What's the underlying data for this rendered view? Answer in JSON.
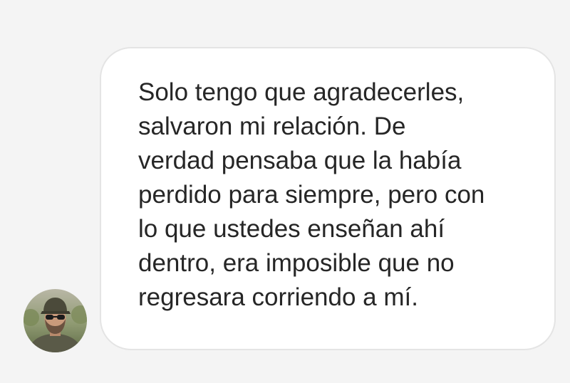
{
  "message": {
    "lines": [
      "Solo tengo que agradecerles,",
      "salvaron mi relación. De",
      "verdad pensaba que la había",
      "perdido para siempre, pero con",
      "lo que ustedes enseñan ahí",
      "dentro, era imposible que no",
      "regresara corriendo a mí."
    ]
  },
  "sender": {
    "avatar": "profile-photo",
    "colors": {
      "bubble": "#ffffff",
      "bubble_border": "#e4e4e4",
      "background": "#f4f4f4",
      "text": "#262626"
    }
  }
}
